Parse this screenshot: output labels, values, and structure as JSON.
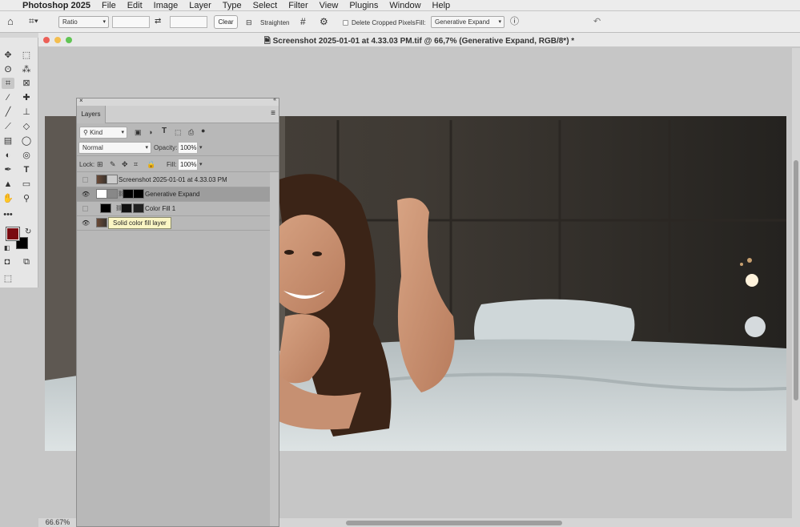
{
  "menubar": {
    "app": "Photoshop 2025",
    "items": [
      "File",
      "Edit",
      "Image",
      "Layer",
      "Type",
      "Select",
      "Filter",
      "View",
      "Plugins",
      "Window",
      "Help"
    ]
  },
  "options": {
    "ratio_label": "Ratio",
    "clear_label": "Clear",
    "straighten_label": "Straighten",
    "delete_cropped_label": "Delete Cropped Pixels",
    "fill_label": "Fill:",
    "fill_value": "Generative Expand"
  },
  "document": {
    "title": "Screenshot 2025-01-01 at 4.33.03 PM.tif @ 66,7% (Generative Expand, RGB/8*) *"
  },
  "status": {
    "zoom": "66.67%"
  },
  "layers_panel": {
    "tab": "Layers",
    "kind": "Kind",
    "blend_mode": "Normal",
    "opacity_label": "Opacity:",
    "opacity_value": "100%",
    "lock_label": "Lock:",
    "fill_label": "Fill:",
    "fill_value": "100%",
    "layers": [
      {
        "name": "Screenshot 2025-01-01 at 4.33.03 PM",
        "visible": false
      },
      {
        "name": "Generative Expand",
        "visible": true,
        "selected": true
      },
      {
        "name": "Color Fill 1",
        "visible": false
      },
      {
        "name": "",
        "visible": true
      }
    ],
    "tooltip": "Solid color fill layer"
  },
  "colors": {
    "foreground": "#7a0a10",
    "background": "#000000",
    "selected_row": "#9d9d9d"
  }
}
